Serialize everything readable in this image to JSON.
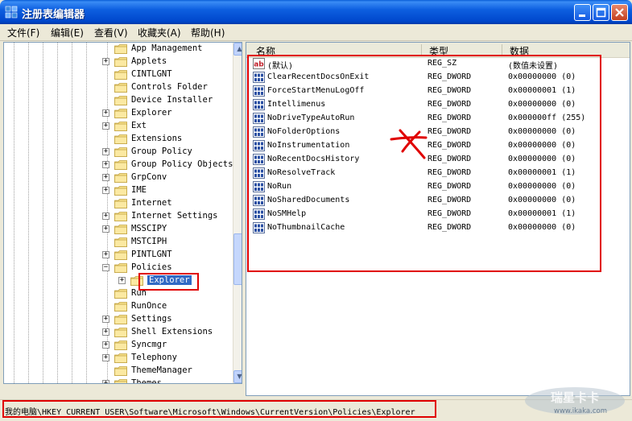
{
  "window": {
    "title": "注册表编辑器"
  },
  "menu": [
    {
      "label": "文件(F)"
    },
    {
      "label": "编辑(E)"
    },
    {
      "label": "查看(V)"
    },
    {
      "label": "收藏夹(A)"
    },
    {
      "label": "帮助(H)"
    }
  ],
  "tree": [
    {
      "label": "App Management",
      "expandable": false,
      "depth": 0
    },
    {
      "label": "Applets",
      "expandable": true,
      "depth": 0
    },
    {
      "label": "CINTLGNT",
      "expandable": false,
      "depth": 0
    },
    {
      "label": "Controls Folder",
      "expandable": false,
      "depth": 0
    },
    {
      "label": "Device Installer",
      "expandable": false,
      "depth": 0
    },
    {
      "label": "Explorer",
      "expandable": true,
      "depth": 0
    },
    {
      "label": "Ext",
      "expandable": true,
      "depth": 0
    },
    {
      "label": "Extensions",
      "expandable": false,
      "depth": 0
    },
    {
      "label": "Group Policy",
      "expandable": true,
      "depth": 0
    },
    {
      "label": "Group Policy Objects",
      "expandable": true,
      "depth": 0
    },
    {
      "label": "GrpConv",
      "expandable": true,
      "depth": 0
    },
    {
      "label": "IME",
      "expandable": true,
      "depth": 0
    },
    {
      "label": "Internet",
      "expandable": false,
      "depth": 0
    },
    {
      "label": "Internet Settings",
      "expandable": true,
      "depth": 0
    },
    {
      "label": "MSSCIPY",
      "expandable": true,
      "depth": 0
    },
    {
      "label": "MSTCIPH",
      "expandable": false,
      "depth": 0
    },
    {
      "label": "PINTLGNT",
      "expandable": true,
      "depth": 0
    },
    {
      "label": "Policies",
      "expandable": true,
      "expanded": true,
      "depth": 0
    },
    {
      "label": "Explorer",
      "expandable": true,
      "depth": 1,
      "selected": true
    },
    {
      "label": "Run",
      "expandable": false,
      "depth": 0
    },
    {
      "label": "RunOnce",
      "expandable": false,
      "depth": 0
    },
    {
      "label": "Settings",
      "expandable": true,
      "depth": 0
    },
    {
      "label": "Shell Extensions",
      "expandable": true,
      "depth": 0
    },
    {
      "label": "Syncmgr",
      "expandable": true,
      "depth": 0
    },
    {
      "label": "Telephony",
      "expandable": true,
      "depth": 0
    },
    {
      "label": "ThemeManager",
      "expandable": false,
      "depth": 0
    },
    {
      "label": "Themes",
      "expandable": true,
      "depth": 0
    }
  ],
  "list": {
    "columns": [
      "名称",
      "类型",
      "数据"
    ],
    "rows": [
      {
        "name": "(默认)",
        "type": "REG_SZ",
        "data": "(数值未设置)",
        "icon": "string-value-icon"
      },
      {
        "name": "ClearRecentDocsOnExit",
        "type": "REG_DWORD",
        "data": "0x00000000 (0)",
        "icon": "dword-value-icon"
      },
      {
        "name": "ForceStartMenuLogOff",
        "type": "REG_DWORD",
        "data": "0x00000001 (1)",
        "icon": "dword-value-icon"
      },
      {
        "name": "Intellimenus",
        "type": "REG_DWORD",
        "data": "0x00000000 (0)",
        "icon": "dword-value-icon"
      },
      {
        "name": "NoDriveTypeAutoRun",
        "type": "REG_DWORD",
        "data": "0x000000ff (255)",
        "icon": "dword-value-icon"
      },
      {
        "name": "NoFolderOptions",
        "type": "REG_DWORD",
        "data": "0x00000000 (0)",
        "icon": "dword-value-icon"
      },
      {
        "name": "NoInstrumentation",
        "type": "REG_DWORD",
        "data": "0x00000000 (0)",
        "icon": "dword-value-icon"
      },
      {
        "name": "NoRecentDocsHistory",
        "type": "REG_DWORD",
        "data": "0x00000000 (0)",
        "icon": "dword-value-icon"
      },
      {
        "name": "NoResolveTrack",
        "type": "REG_DWORD",
        "data": "0x00000001 (1)",
        "icon": "dword-value-icon"
      },
      {
        "name": "NoRun",
        "type": "REG_DWORD",
        "data": "0x00000000 (0)",
        "icon": "dword-value-icon"
      },
      {
        "name": "NoSharedDocuments",
        "type": "REG_DWORD",
        "data": "0x00000000 (0)",
        "icon": "dword-value-icon"
      },
      {
        "name": "NoSMHelp",
        "type": "REG_DWORD",
        "data": "0x00000001 (1)",
        "icon": "dword-value-icon"
      },
      {
        "name": "NoThumbnailCache",
        "type": "REG_DWORD",
        "data": "0x00000000 (0)",
        "icon": "dword-value-icon"
      }
    ]
  },
  "status": {
    "path": "我的电脑\\HKEY_CURRENT_USER\\Software\\Microsoft\\Windows\\CurrentVersion\\Policies\\Explorer"
  },
  "watermark": {
    "line1": "瑞星卡卡",
    "line2": "www.ikaka.com"
  },
  "colors": {
    "annotation": "#e00000",
    "title_bar": "#0a5fd8",
    "selection": "#316ac5"
  }
}
